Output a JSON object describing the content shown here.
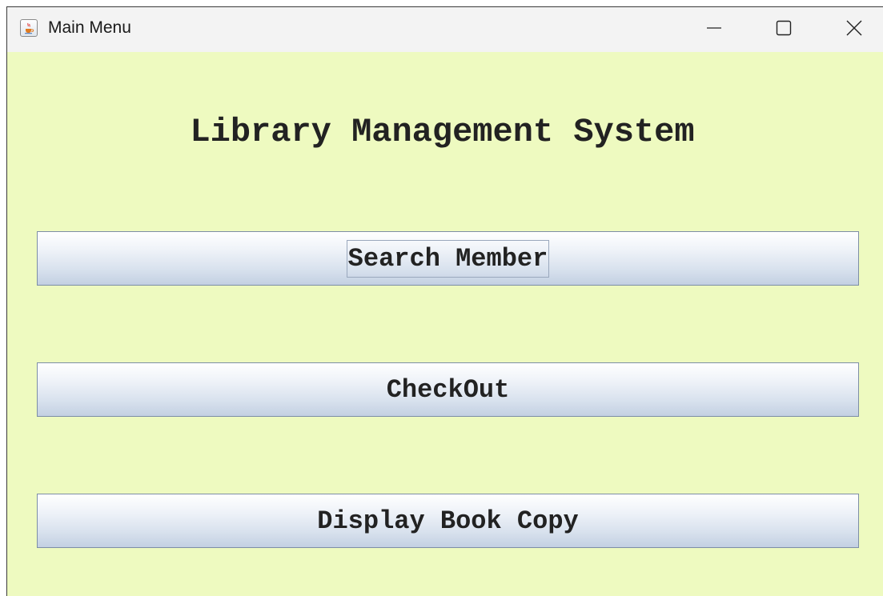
{
  "window": {
    "title": "Main Menu",
    "app_icon": "java-coffee-cup-icon",
    "controls": {
      "minimize_icon": "minimize-icon",
      "maximize_icon": "maximize-icon",
      "close_icon": "close-icon"
    }
  },
  "main": {
    "heading": "Library Management System",
    "buttons": [
      {
        "label": "Search Member",
        "focused": true
      },
      {
        "label": "CheckOut",
        "focused": false
      },
      {
        "label": "Display Book Copy",
        "focused": false
      }
    ]
  },
  "colors": {
    "background": "#eefac0",
    "titlebar": "#f3f3f3",
    "button_border": "#7d8ea6",
    "text": "#222222"
  }
}
